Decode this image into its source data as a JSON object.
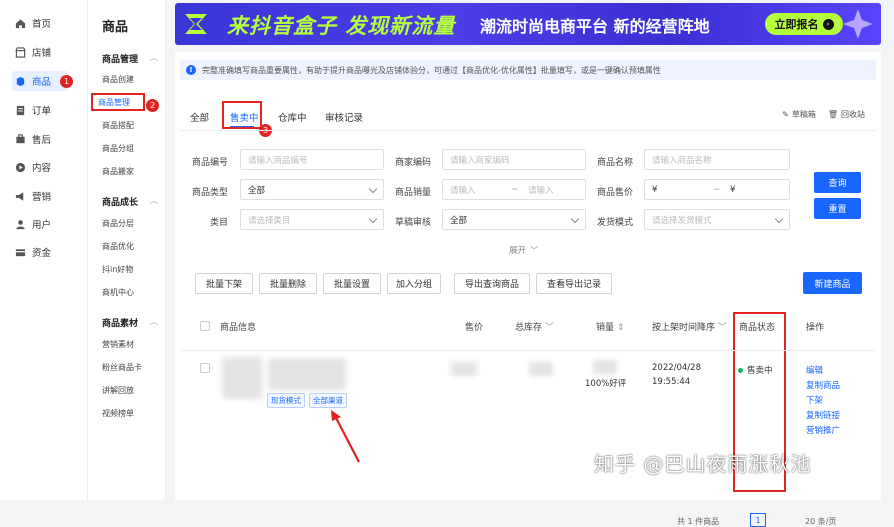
{
  "nav": {
    "items": [
      {
        "label": "首页",
        "icon": "home-icon"
      },
      {
        "label": "店铺",
        "icon": "store-icon"
      },
      {
        "label": "商品",
        "icon": "product-icon",
        "active": true,
        "badge": "1"
      },
      {
        "label": "订单",
        "icon": "order-icon"
      },
      {
        "label": "售后",
        "icon": "aftersale-icon"
      },
      {
        "label": "内容",
        "icon": "content-icon"
      },
      {
        "label": "营销",
        "icon": "marketing-icon"
      },
      {
        "label": "用户",
        "icon": "user-icon"
      },
      {
        "label": "资金",
        "icon": "fund-icon"
      }
    ]
  },
  "submenu": {
    "title": "商品",
    "groups": [
      {
        "label": "商品管理",
        "items": [
          "商品创建",
          "商品管理",
          "商品搭配",
          "商品分组",
          "商品搬家"
        ]
      },
      {
        "label": "商品成长",
        "items": [
          "商品分层",
          "商品优化",
          "抖in好物",
          "商机中心"
        ]
      },
      {
        "label": "商品素材",
        "items": [
          "营销素材",
          "粉丝商品卡",
          "讲解回放",
          "视频榜单"
        ]
      }
    ],
    "selected_badge": "2"
  },
  "banner": {
    "title": "来抖音盒子 发现新流量",
    "subtitle": "潮流时尚电商平台 新的经营阵地",
    "button": "立即报名"
  },
  "notice": {
    "text": "完整准确填写商品重要属性，有助于提升商品曝光及店铺体验分，可通过【商品优化-优化属性】批量填写，或是一键确认预填属性"
  },
  "tabs": {
    "items": [
      "全部",
      "售卖中",
      "仓库中",
      "审核记录"
    ],
    "active_index": 1,
    "badge": "3",
    "draft_label": "草稿箱",
    "recycle_label": "回收站"
  },
  "filters": {
    "product_id": {
      "label": "商品编号",
      "placeholder": "请输入商品编号"
    },
    "merchant_code": {
      "label": "商家编码",
      "placeholder": "请输入商家编码"
    },
    "product_name": {
      "label": "商品名称",
      "placeholder": "请输入商品名称"
    },
    "product_type": {
      "label": "商品类型",
      "value": "全部"
    },
    "sales": {
      "label": "商品销量",
      "from": "请输入",
      "sep": "~",
      "to": "请输入"
    },
    "price": {
      "label": "商品售价",
      "from": "¥",
      "sep": "~",
      "to": "¥"
    },
    "category": {
      "label": "类目",
      "placeholder": "请选择类目"
    },
    "draft_review": {
      "label": "草稿审核",
      "value": "全部"
    },
    "ship_mode": {
      "label": "发货模式",
      "placeholder": "请选择发货模式"
    },
    "expand_label": "展开",
    "query_button": "查询",
    "reset_button": "重置"
  },
  "actions": {
    "buttons": [
      "批量下架",
      "批量删除",
      "批量设置",
      "加入分组",
      "导出查询商品",
      "查看导出记录"
    ],
    "create_button": "新建商品"
  },
  "table": {
    "headers": {
      "info": "商品信息",
      "price": "售价",
      "stock": "总库存",
      "sales": "销量",
      "listed_time": "按上架时间降序",
      "status": "商品状态",
      "ops": "操作"
    },
    "rows": [
      {
        "tags": [
          "现货模式",
          "全部渠道"
        ],
        "rating": "100%好评",
        "date": "2022/04/28",
        "time": "19:55:44",
        "status": "售卖中",
        "operations": [
          "编辑",
          "复制商品",
          "下架",
          "复制链接",
          "营销推广"
        ]
      }
    ]
  },
  "pagination": {
    "total": "共 1 件商品",
    "page": "1",
    "page_size": "20 条/页"
  },
  "watermark": "知乎 @巴山夜雨涨秋池",
  "colors": {
    "accent": "#1966ff",
    "annotation": "#e02424",
    "success": "#22b35e",
    "banner": "#3a36d8",
    "banner_accent": "#b6ff3b"
  }
}
